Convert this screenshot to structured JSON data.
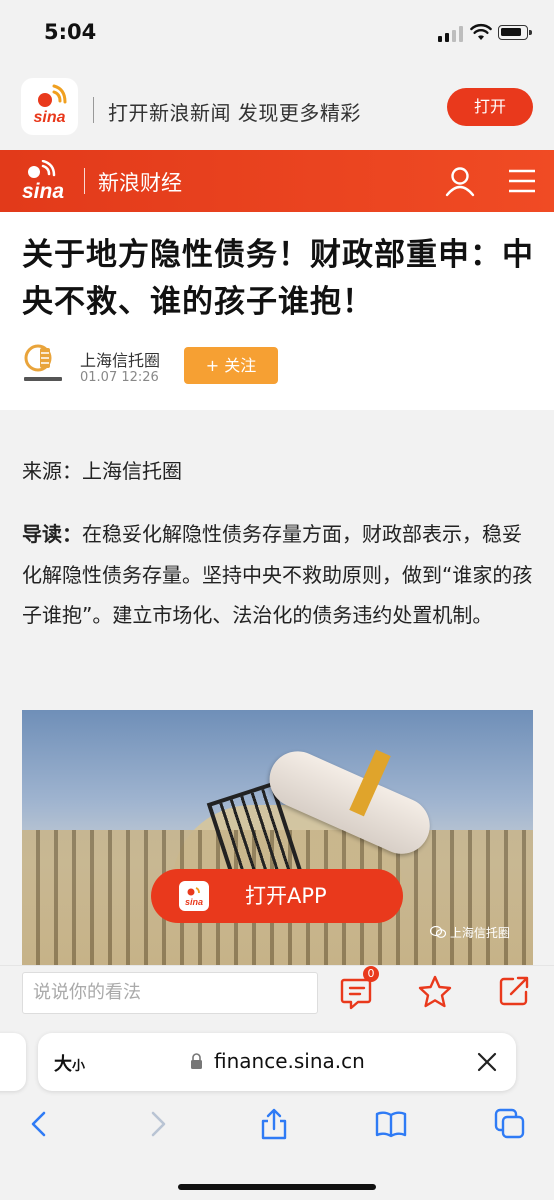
{
  "status_bar": {
    "time": "5:04"
  },
  "promo": {
    "text": "打开新浪新闻 发现更多精彩",
    "open_label": "打开"
  },
  "header": {
    "title": "新浪财经"
  },
  "article": {
    "title": "关于地方隐性债务！财政部重申：中央不救、谁的孩子谁抱！",
    "author": "上海信托圈",
    "time": "01.07 12:26",
    "follow_label": "+ 关注",
    "source": "来源：上海信托圈",
    "intro_label": "导读：",
    "intro_text": "在稳妥化解隐性债务存量方面，财政部表示，稳妥化解隐性债务存量。坚持中央不救助原则，做到“谁家的孩子谁抱”。建立市场化、法治化的债务违约处置机制。",
    "image_watermark": "上海信托圈"
  },
  "open_app": {
    "label": "打开APP"
  },
  "comment_bar": {
    "placeholder": "说说你的看法",
    "comment_count": "0"
  },
  "browser": {
    "text_size_label": "大",
    "text_size_small": "小",
    "url": "finance.sina.cn"
  },
  "colors": {
    "brand_red": "#e9391c",
    "follow_orange": "#f6a033"
  },
  "icons": [
    "sina-logo-icon",
    "user-icon",
    "menu-icon",
    "comment-icon",
    "star-icon",
    "share-icon",
    "lock-icon",
    "close-icon",
    "back-icon",
    "forward-icon",
    "share-sheet-icon",
    "bookmarks-icon",
    "tabs-icon"
  ]
}
